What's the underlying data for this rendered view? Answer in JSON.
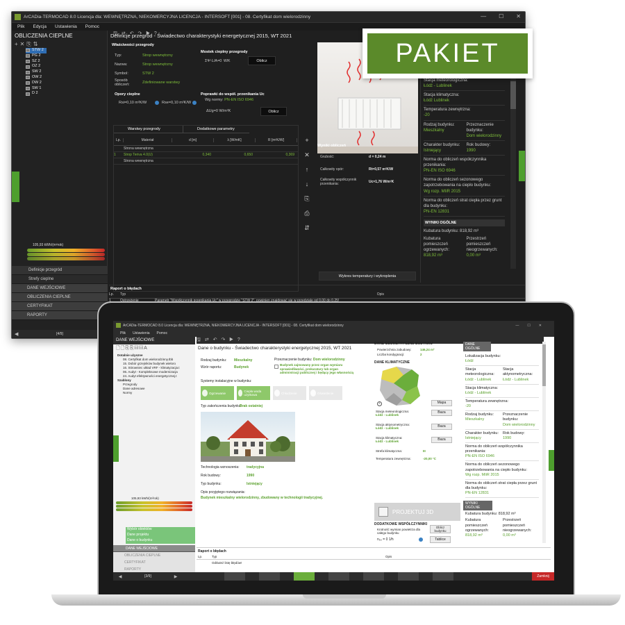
{
  "badge": {
    "text": "PAKIET"
  },
  "back": {
    "title": "ArCADia-TERMOCAD 8.0 Licencja dla: WEWNĘTRZNA, NIEKOMERCYJNA LICENCJA - INTERSOFT [001] - 08. Certyfikat dom wielorodzinny",
    "menu": [
      "Plik",
      "Edycja",
      "Ustawienia",
      "Pomoc"
    ],
    "sidebar_title": "OBLICZENIA CIEPLNE",
    "tree": [
      "STW 2",
      "PG 2",
      "SZ 2",
      "OZ 2",
      "SW 2",
      "OW 2",
      "DW 2",
      "SW 1",
      "D 2"
    ],
    "gauge_value": "105,93 kWh/(m²rok)",
    "nav": [
      "Definicje przegród",
      "Strefy cieplne"
    ],
    "sections": [
      "DANE WEJŚCIOWE",
      "OBLICZENIA CIEPLNE",
      "CERTYFIKAT",
      "RAPORTY"
    ],
    "pager": "[4/9]",
    "main_title": "Definicje przegród - Świadectwo charakterystyki energetycznej 2015, WT 2021",
    "props_title": "Właściwości przegrody",
    "props": [
      {
        "label": "Typ:",
        "value": "Strop wewnętrzny"
      },
      {
        "label": "Nazwa:",
        "value": "Strop wewnętrzny"
      },
      {
        "label": "Symbol:",
        "value": "STW 2"
      },
      {
        "label": "Sposób obliczeń:",
        "value": "Zdefiniowane warstwy"
      }
    ],
    "bridge_title": "Mostek cieplny przegrody",
    "bridge_formula": "ΣΨ·L/A=0",
    "bridge_unit": "W/K",
    "calc_btn": "Oblicz",
    "resist_title": "Opory cieplne",
    "rsi": "Rsi=0,10",
    "rse": "Rse=0,10",
    "resist_unit": "m²K/W",
    "corr_title": "Poprawki do współ. przenikania Uc",
    "norm_label": "Wg normy:",
    "norm_value": "PN-EN ISO 6946",
    "du": "ΔUg=0",
    "du_unit": "W/m²K",
    "layers_tab": "Warstwy przegrody",
    "params_tab": "Dodatkowe parametry",
    "cols": [
      "Lp.",
      "Materiał",
      "d [m]",
      "λ [W/mK]",
      "R [m²K/W]"
    ],
    "rows": [
      {
        "lp": "",
        "mat": "Strona wewnętrzna",
        "d": "",
        "l": "",
        "r": ""
      },
      {
        "lp": "1",
        "mat": "Strop Teriva 4.0(U)",
        "d": "0,340",
        "l": "0,650",
        "r": "0,369"
      },
      {
        "lp": "",
        "mat": "Strona wewnętrzna",
        "d": "",
        "l": "",
        "r": ""
      }
    ],
    "results_title": "Wyniki obliczeń",
    "results": [
      {
        "label": "Grubość:",
        "value": "d = 0,24 m"
      },
      {
        "label": "Całkowity opór:",
        "value": "Rt=0,57 m²K/W"
      },
      {
        "label": "Całkowity współczynnik przenikania:",
        "value": "Uc=1,76 W/m²K"
      }
    ],
    "chart_btn": "Wykres temperatury i wykroplenia",
    "report_title": "Raport o błędach",
    "report_cols": [
      "Lp.",
      "Typ",
      "Opis"
    ],
    "report_row": [
      "1",
      "Ostrzeżenie",
      "Parametr \"Współczynnik przenikania Uc\" w przegrodzie \"STW 2\", powinien znajdować się w przedziale od 0,00 do 0,25!"
    ],
    "right": [
      {
        "label": "Stacja meteorologiczna:",
        "value": "Łódź - Lublinek"
      },
      {
        "label": "Stacja klimatyczna:",
        "value": "Łódź Lublinek"
      },
      {
        "label": "Temperatura zewnętrzna:",
        "value": "-20"
      },
      {
        "label": "Rodzaj budynku:",
        "value": "Mieszkalny"
      },
      {
        "label": "Przeznaczenie budynku:",
        "value": "Dom wielorodzinny"
      },
      {
        "label": "Charakter budynku:",
        "value": "Istniejący"
      },
      {
        "label": "Rok budowy:",
        "value": "1990"
      },
      {
        "label": "Norma do obliczeń współczynnika przenikania:",
        "value": "PN-EN ISO 6946"
      },
      {
        "label": "Norma do obliczeń sezonowego zapotrzebowania na ciepło budynku:",
        "value": "Wg rozp. MIiR 2015"
      },
      {
        "label": "Norma do obliczeń strat ciepła przez grunt dla budynku:",
        "value": "PN-EN 12831"
      }
    ],
    "results_general": "WYNIKI OGÓLNE",
    "cubature": "Kubatura budynku: 818,92 m³",
    "heated": "Kubatura pomieszczeń ogrzewanych:",
    "heated_val": "818,92 m³",
    "unheated": "Przestrzeń pomieszczeń nieogrzewanych:",
    "unheated_val": "0,00 m³"
  },
  "front": {
    "title": "ArCADia-TERMOCAD 8.0 Licencja dla: WEWNĘTRZNA, NIEKOMERCYJNA LICENCJA - INTERSOFT [001] - 08. Certyfikat dom wielorodzinny",
    "menu": [
      "Plik",
      "Ustawienia",
      "Pomoc"
    ],
    "sidebar_title": "DANE WEJŚCIOWE",
    "tree": [
      "Dotalnie użyszne",
      "08. Certyfikat dom wielorodzinny.tbb",
      "15. Dobór grzejników budynek wieloro",
      "16. Stirowniec układ VRF - klimatyzacja.t",
      "06. Audyt - Kompleksowe modernizacja",
      "24. Audyt efektywności energetycznej.t",
      "Szablony",
      "Przegrody",
      "Dane adresowe",
      "Normy"
    ],
    "gauge_value": "105,93 kWh/(m²rok)",
    "nav": [
      "Wybór obiektów",
      "Dane projektu",
      "Dane o budynku"
    ],
    "sections": [
      "DANE WEJŚCIOWE",
      "OBLICZENIA CIEPLNE",
      "CERTYFIKAT",
      "RAPORTY"
    ],
    "pager": "[3/9]",
    "main_title": "Dane o budynku - Świadectwo charakterystyki energetycznej 2015, WT 2021",
    "fields": [
      {
        "label": "Rodzaj budynku:",
        "value": "Mieszkalny"
      },
      {
        "label": "Wzór raportu:",
        "value": "Budynek"
      }
    ],
    "purpose_label": "Przeznaczenie budynku:",
    "purpose_value": "Dom wielorodzinny",
    "checkbox_text": "Budynek zajmowany przez organ wymiaru sprawiedliwości, prokuratury lub organ administracji publicznej i będący jego własnością",
    "systems_label": "Systemy instalacyjne w budynku:",
    "systems": [
      "Ogrzewanie",
      "Ciepła woda użytkowa",
      "Chłodzenie",
      "Oświetlenie"
    ],
    "roof_label": "Typ zakończenia budynku:",
    "roof_value": "Brak ostatniej",
    "tech_label": "Technologia wznoszenia:",
    "tech_value": "tradycyjna",
    "year_label": "Rok budowy:",
    "year_value": "1990",
    "type_label": "Typ budynku:",
    "type_value": "Istniejący",
    "desc_label": "Opis przyjętego rozwiązania:",
    "desc_value": "Budynek mieszkalny wielorodzinny, zbudowany w technologii tradycyjnej.",
    "geom_title": "DANE GEOMETRYCZNE BUDYNKU",
    "geom": [
      {
        "label": "Powierzchnia zabudowy:",
        "value": "146,24 m²"
      },
      {
        "label": "Liczba kondygnacji:",
        "value": "2"
      }
    ],
    "climate_title": "DANE KLIMATYCZNE",
    "map_btn": "Mapa",
    "base_btn": "Baza",
    "climate": [
      {
        "label": "Stacja meteorologiczna:",
        "value": "Łódź - Lublinek"
      },
      {
        "label": "Stacja aktynometryczna:",
        "value": "Łódź - Lublinek"
      },
      {
        "label": "Stacja klimatyczna:",
        "value": "Łódź - Lublinek"
      },
      {
        "label": "Strefa klimatyczna:",
        "value": "III"
      },
      {
        "label": "Temperatura zewnętrzna:",
        "value": "-20,00 °C"
      }
    ],
    "project3d": "PROJEKTUJ 3D",
    "extra_title": "DODATKOWE WSPÓŁCZYNNIKI",
    "extra_label": "Krotność wymian powietrza dla całego budynku",
    "extra_formula": "n₅₀ = 0 1/h",
    "extra_btn1": "Oblicz budynku",
    "extra_btn2": "Tablice",
    "building_data": "DANE OGÓLNE",
    "right": [
      {
        "label": "Lokalizacja budynku:",
        "value": "Łódź"
      },
      {
        "label": "Stacja meteorologiczna:",
        "value": "Łódź - Lublinek"
      },
      {
        "label": "Stacja aktynometryczna:",
        "value": "Łódź - Lublinek"
      },
      {
        "label": "Stacja klimatyczna:",
        "value": "Łódź - Lublinek"
      },
      {
        "label": "Temperatura zewnętrzna:",
        "value": "-20"
      },
      {
        "label": "Rodzaj budynku:",
        "value": "Mieszkalny"
      },
      {
        "label": "Przeznaczenie budynku:",
        "value": "Dom wielorodzinny"
      },
      {
        "label": "Charakter budynku:",
        "value": "Istniejący"
      },
      {
        "label": "Rok budowy:",
        "value": "1990"
      },
      {
        "label": "Norma do obliczeń współczynnika przenikania:",
        "value": "PN-EN ISO 6946"
      },
      {
        "label": "Norma do obliczeń sezonowego zapotrzebowania na ciepło budynku:",
        "value": "Wg rozp. MIiR 2015"
      },
      {
        "label": "Norma do obliczeń strat ciepła przez grunt dla budynku:",
        "value": "PN-EN 12831"
      }
    ],
    "results_general": "WYNIKI OGÓLNE",
    "cubature": "Kubatura budynku: 818,92 m³",
    "heated": "Kubatura pomieszczeń ogrzewanych:",
    "heated_val": "818,92 m³",
    "unheated": "Przestrzeń pomieszczeń nieogrzewanych:",
    "unheated_val": "0,00 m³",
    "report_title": "Raport o błędach",
    "report_cols": [
      "Lp.",
      "Typ",
      "Opis"
    ],
    "report_row": "Odśwież listę błędów!",
    "close_btn": "Zamknij"
  },
  "colors": {
    "accent": "#7fbf3a",
    "badge": "#5b8a2a",
    "close": "#c62828"
  }
}
